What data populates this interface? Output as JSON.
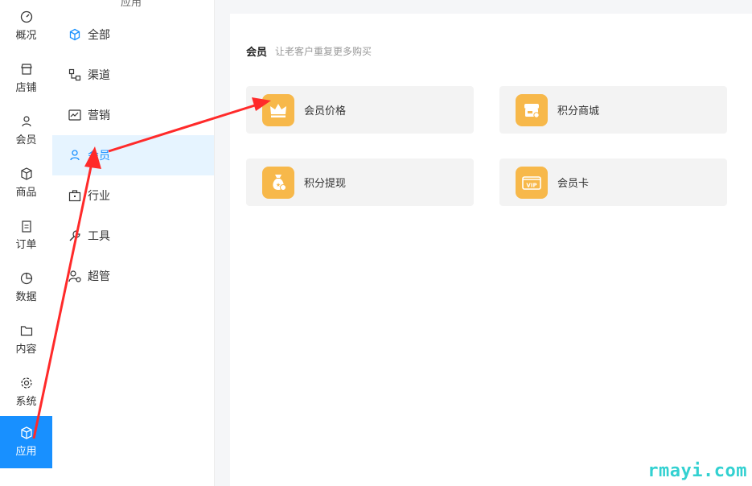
{
  "rail": {
    "items": [
      {
        "label": "概况",
        "icon": "dashboard-icon"
      },
      {
        "label": "店铺",
        "icon": "store-icon"
      },
      {
        "label": "会员",
        "icon": "user-icon"
      },
      {
        "label": "商品",
        "icon": "box-icon"
      },
      {
        "label": "订单",
        "icon": "clipboard-icon"
      },
      {
        "label": "数据",
        "icon": "pie-icon"
      },
      {
        "label": "内容",
        "icon": "folder-icon"
      },
      {
        "label": "系统",
        "icon": "gear-icon"
      },
      {
        "label": "应用",
        "icon": "app-icon",
        "active": true
      }
    ]
  },
  "submenu": {
    "top_label": "应用",
    "items": [
      {
        "label": "全部",
        "icon": "cube-icon"
      },
      {
        "label": "渠道",
        "icon": "channel-icon"
      },
      {
        "label": "营销",
        "icon": "chart-icon"
      },
      {
        "label": "会员",
        "icon": "user-icon",
        "active": true
      },
      {
        "label": "行业",
        "icon": "briefcase-icon"
      },
      {
        "label": "工具",
        "icon": "tool-icon"
      },
      {
        "label": "超管",
        "icon": "admin-icon"
      }
    ]
  },
  "main": {
    "section_title": "会员",
    "section_desc": "让老客户重复更多购买",
    "cards": [
      {
        "label": "会员价格",
        "icon": "crown-icon"
      },
      {
        "label": "积分商城",
        "icon": "shop-icon"
      },
      {
        "label": "积分提现",
        "icon": "moneybag-icon"
      },
      {
        "label": "会员卡",
        "icon": "vip-card-icon"
      }
    ]
  },
  "watermark": "rmayi.com",
  "colors": {
    "accent": "#1890ff",
    "badge": "#f7b84a",
    "arrow": "#ff2a2a"
  }
}
